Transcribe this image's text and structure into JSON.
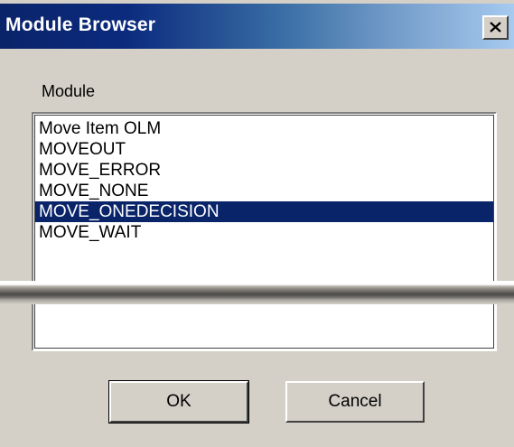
{
  "window": {
    "title": "Module Browser"
  },
  "title_bar": {
    "close_icon": "close-x-icon"
  },
  "module_group": {
    "label": "Module",
    "items": [
      {
        "label": "Move Item OLM",
        "selected": false
      },
      {
        "label": "MOVEOUT",
        "selected": false
      },
      {
        "label": "MOVE_ERROR",
        "selected": false
      },
      {
        "label": "MOVE_NONE",
        "selected": false
      },
      {
        "label": "MOVE_ONEDECISION",
        "selected": true
      },
      {
        "label": "MOVE_WAIT",
        "selected": false
      }
    ]
  },
  "buttons": {
    "ok_label": "OK",
    "cancel_label": "Cancel"
  },
  "colors": {
    "title_bar_start": "#0a246a",
    "title_bar_end": "#a6caf0",
    "dialog_face": "#d4d0c8",
    "selection": "#0a246a"
  }
}
